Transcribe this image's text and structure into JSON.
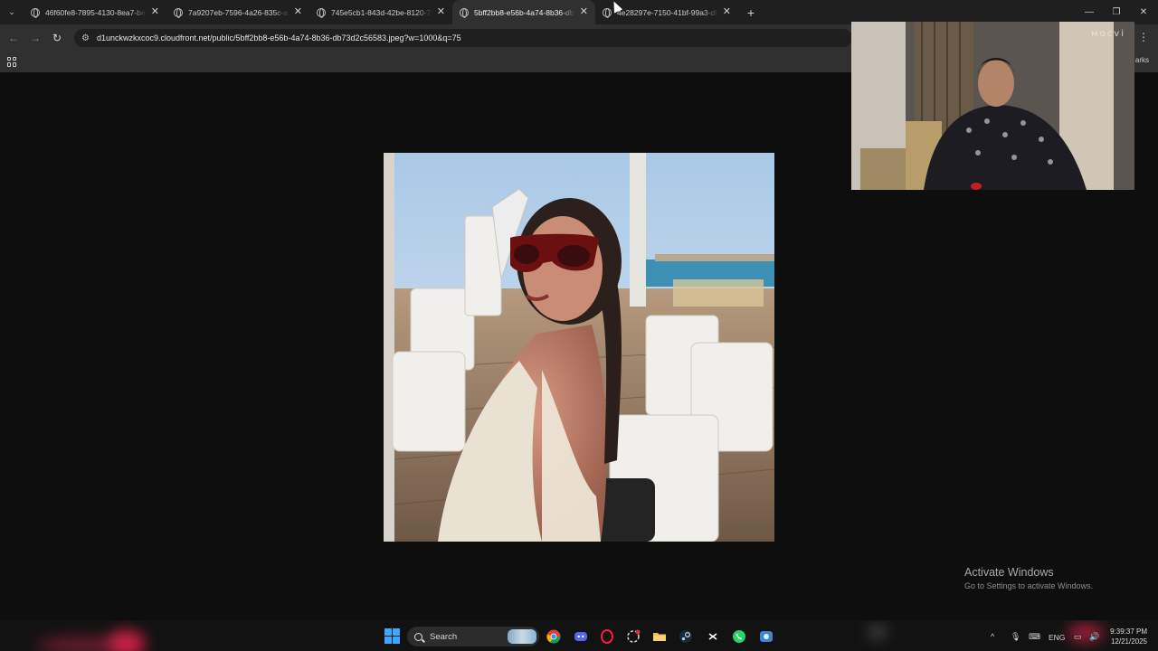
{
  "browser": {
    "tabs": [
      {
        "title": "46f60fe8-7895-4130-8ea7-bed",
        "close": "✕",
        "active": false
      },
      {
        "title": "7a9207eb-7596-4a26-835c-a1",
        "close": "✕",
        "active": false
      },
      {
        "title": "745e5cb1-843d-42be-8120-7f",
        "close": "✕",
        "active": false
      },
      {
        "title": "5bff2bb8-e56b-4a74-8b36-db7",
        "close": "✕",
        "active": true
      },
      {
        "title": "4e28297e-7150-41bf-99a3-db",
        "close": "✕",
        "active": false
      }
    ],
    "new_tab": "+",
    "address": "d1unckwzkxcoc9.cloudfront.net/public/5bff2bb8-e56b-4a74-8b36-db73d2c56583.jpeg?w=1000&q=75",
    "bookmarks_label": "arks"
  },
  "webcam": {
    "watermark": "ᴍocvi"
  },
  "watermark": {
    "title": "Activate Windows",
    "subtitle": "Go to Settings to activate Windows."
  },
  "taskbar": {
    "search_label": "Search",
    "language": "ENG",
    "time": "9:39:37 PM",
    "date": "12/21/2025"
  },
  "colors": {
    "chrome_dark": "#1f1f1f",
    "chrome_toolbar": "#303030",
    "viewer_bg": "#0e0e0e",
    "windows_blue": "#3fa7ff"
  }
}
